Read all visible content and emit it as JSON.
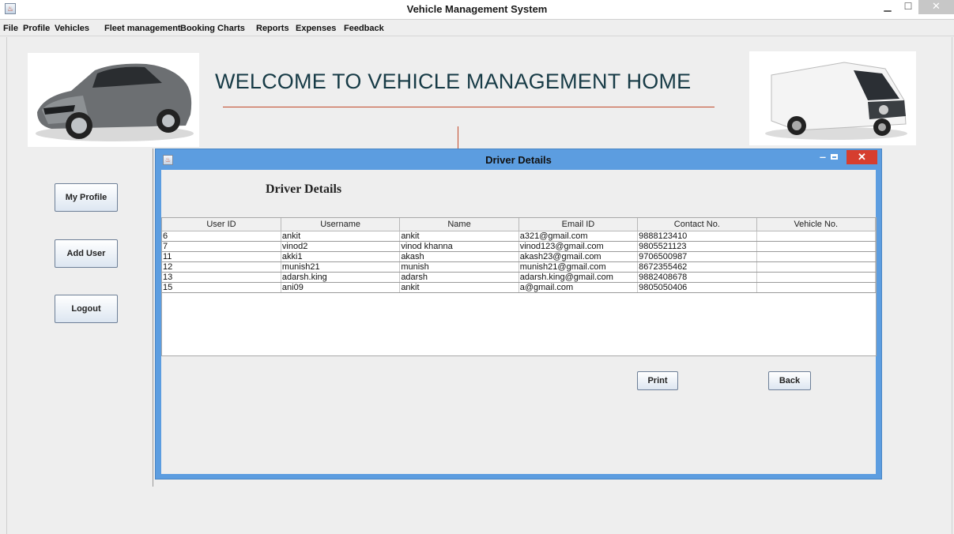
{
  "window": {
    "title": "Vehicle Management System"
  },
  "menu": [
    "File",
    "Profile",
    "Vehicles",
    "Fleet management",
    "Booking Charts",
    "Reports",
    "Expenses",
    "Feedback"
  ],
  "home": {
    "welcome": "WELCOME TO VEHICLE MANAGEMENT HOME"
  },
  "sidebar": {
    "my_profile": "My Profile",
    "add_user": "Add User",
    "logout": "Logout"
  },
  "dialog": {
    "title": "Driver Details",
    "heading": "Driver Details",
    "columns": [
      "User ID",
      "Username",
      "Name",
      "Email ID",
      "Contact No.",
      "Vehicle No."
    ],
    "rows": [
      [
        "6",
        "ankit",
        "ankit",
        "a321@gmail.com",
        "9888123410",
        ""
      ],
      [
        "7",
        "vinod2",
        "vinod khanna",
        "vinod123@gmail.com",
        "9805521123",
        ""
      ],
      [
        "11",
        "akki1",
        "akash",
        "akash23@gmail.com",
        "9706500987",
        ""
      ],
      [
        "12",
        "munish21",
        "munish",
        "munish21@gmail.com",
        "8672355462",
        ""
      ],
      [
        "13",
        "adarsh.king",
        "adarsh",
        "adarsh.king@gmail.com",
        "9882408678",
        ""
      ],
      [
        "15",
        "ani09",
        "ankit",
        "a@gmail.com",
        "9805050406",
        ""
      ]
    ],
    "print_label": "Print",
    "back_label": "Back"
  }
}
